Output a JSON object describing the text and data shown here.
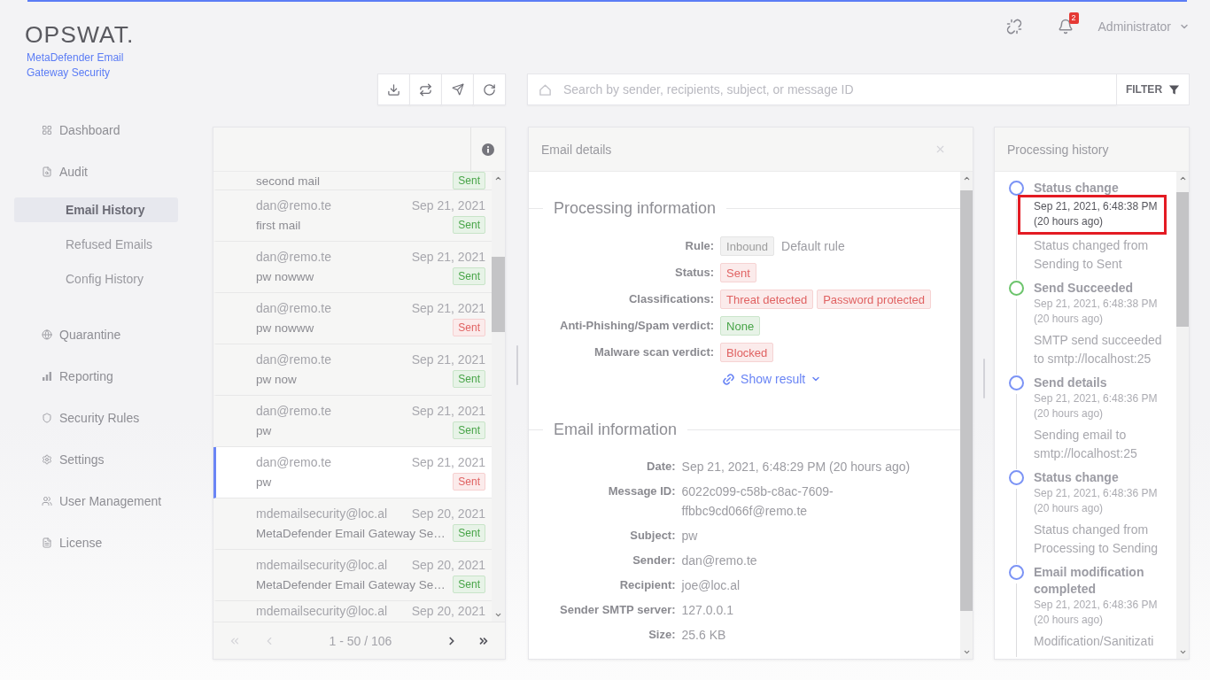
{
  "header": {
    "notification_count": "2",
    "user": "Administrator"
  },
  "brand": {
    "logo": "OPSWAT.",
    "product": "MetaDefender Email Gateway Security"
  },
  "sidebar": {
    "items": [
      {
        "label": "Dashboard",
        "selected": false
      },
      {
        "label": "Audit",
        "selected": false,
        "children": [
          {
            "label": "Email History",
            "selected": true
          },
          {
            "label": "Refused Emails",
            "selected": false
          },
          {
            "label": "Config History",
            "selected": false
          }
        ]
      },
      {
        "label": "Quarantine",
        "selected": false
      },
      {
        "label": "Reporting",
        "selected": false
      },
      {
        "label": "Security Rules",
        "selected": false
      },
      {
        "label": "Settings",
        "selected": false
      },
      {
        "label": "User Management",
        "selected": false
      },
      {
        "label": "License",
        "selected": false
      }
    ]
  },
  "search": {
    "placeholder": "Search by sender, recipients, subject, or message ID",
    "filter_button": "FILTER"
  },
  "email_list": {
    "rows": [
      {
        "subject": "second mail",
        "status": "Sent",
        "color": "#47a447",
        "selected": false
      },
      {
        "sender": "dan@remo.te",
        "date": "Sep 21, 2021",
        "subject": "first mail",
        "status": "Sent",
        "color": "#47a447",
        "selected": false
      },
      {
        "sender": "dan@remo.te",
        "date": "Sep 21, 2021",
        "subject": "pw nowww",
        "status": "Sent",
        "color": "#47a447",
        "selected": false
      },
      {
        "sender": "dan@remo.te",
        "date": "Sep 21, 2021",
        "subject": "pw nowww",
        "status": "Sent",
        "color": "#e06262",
        "selected": false
      },
      {
        "sender": "dan@remo.te",
        "date": "Sep 21, 2021",
        "subject": "pw now",
        "status": "Sent",
        "color": "#47a447",
        "selected": false
      },
      {
        "sender": "dan@remo.te",
        "date": "Sep 21, 2021",
        "subject": "pw",
        "status": "Sent",
        "color": "#47a447",
        "selected": false
      },
      {
        "sender": "dan@remo.te",
        "date": "Sep 21, 2021",
        "subject": "pw",
        "status": "Sent",
        "color": "#e06262",
        "selected": true
      },
      {
        "sender": "mdemailsecurity@loc.al",
        "date": "Sep 20, 2021",
        "subject": "MetaDefender Email Gateway Se…",
        "status": "Sent",
        "color": "#47a447",
        "selected": false
      },
      {
        "sender": "mdemailsecurity@loc.al",
        "date": "Sep 20, 2021",
        "subject": "MetaDefender Email Gateway Se…",
        "status": "Sent",
        "color": "#47a447",
        "selected": false
      },
      {
        "sender": "mdemailsecurity@loc.al",
        "date": "Sep 20, 2021",
        "selected": false
      }
    ],
    "pagination": {
      "range": "1 - 50 / 106",
      "buttons": [
        {
          "kind": "first",
          "disabled": true
        },
        {
          "kind": "previous",
          "disabled": true
        },
        {
          "kind": "next",
          "disabled": false
        },
        {
          "kind": "last",
          "disabled": false
        }
      ]
    }
  },
  "email_details": {
    "title": "Email details",
    "sections": [
      {
        "heading": "Processing information",
        "fields": [
          {
            "label": "Rule:",
            "tags": [
              {
                "text": "Inbound",
                "color": "#9e9e9e"
              }
            ],
            "text": "Default rule"
          },
          {
            "label": "Status:",
            "tags": [
              {
                "text": "Sent",
                "color": "#e06262"
              }
            ]
          },
          {
            "label": "Classifications:",
            "tags": [
              {
                "text": "Threat detected",
                "color": "#e06262"
              },
              {
                "text": "Password protected",
                "color": "#e06262"
              }
            ]
          },
          {
            "label": "Anti-Phishing/Spam verdict:",
            "tags": [
              {
                "text": "None",
                "color": "#47a447"
              }
            ]
          },
          {
            "label": "Malware scan verdict:",
            "tags": [
              {
                "text": "Blocked",
                "color": "#e06262"
              }
            ]
          }
        ],
        "link": "Show result"
      },
      {
        "heading": "Email information",
        "fields": [
          {
            "label": "Date:",
            "text": "Sep 21, 2021, 6:48:29 PM (20 hours ago)"
          },
          {
            "label": "Message ID:",
            "text": "6022c099-c58b-c8ac-7609-ffbbc9cd066f@remo.te"
          },
          {
            "label": "Subject:",
            "text": "pw"
          },
          {
            "label": "Sender:",
            "text": "dan@remo.te"
          },
          {
            "label": "Recipient:",
            "text": "joe@loc.al"
          },
          {
            "label": "Sender SMTP server:",
            "text": "127.0.0.1"
          },
          {
            "label": "Size:",
            "text": "25.6 KB"
          }
        ]
      }
    ]
  },
  "processing_history": {
    "title": "Processing history",
    "items": [
      {
        "title": "Status change",
        "timestamp": "Sep 21, 2021, 6:48:38 PM (20 hours ago)",
        "description": "Status changed from Sending to Sent",
        "color": "#7b93f5",
        "highlighted": true
      },
      {
        "title": "Send Succeeded",
        "timestamp": "Sep 21, 2021, 6:48:38 PM (20 hours ago)",
        "description": "SMTP send succeeded to smtp://localhost:25",
        "color": "#6cc46c",
        "highlighted": false
      },
      {
        "title": "Send details",
        "timestamp": "Sep 21, 2021, 6:48:36 PM (20 hours ago)",
        "description": "Sending email to smtp://localhost:25",
        "color": "#7b93f5",
        "highlighted": false
      },
      {
        "title": "Status change",
        "timestamp": "Sep 21, 2021, 6:48:36 PM (20 hours ago)",
        "description": "Status changed from Processing to Sending",
        "color": "#7b93f5",
        "highlighted": false
      },
      {
        "title": "Email modification completed",
        "timestamp": "Sep 21, 2021, 6:48:36 PM (20 hours ago)",
        "description": "Modification/Sanitizati",
        "color": "#7b93f5",
        "highlighted": false
      }
    ]
  }
}
